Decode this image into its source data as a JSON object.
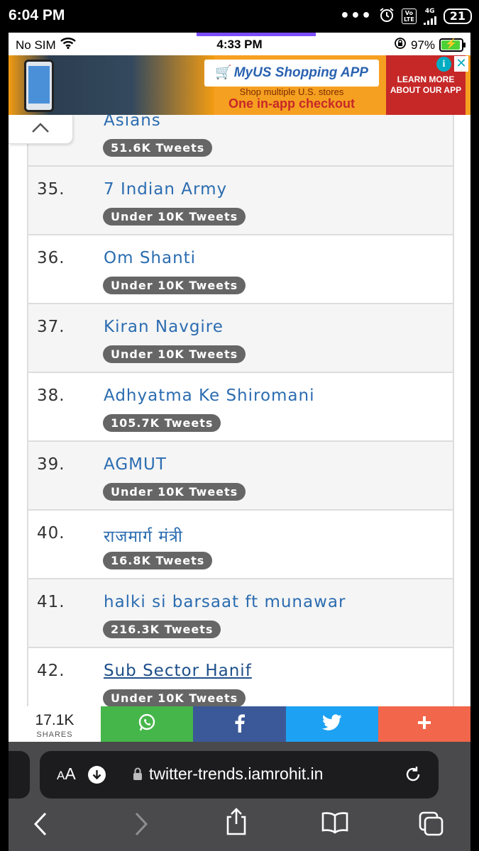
{
  "android_status": {
    "time": "6:04 PM",
    "dots": "•••",
    "volte": "Vo\nLTE",
    "network": "4G",
    "battery": "21"
  },
  "ios_status": {
    "carrier": "No SIM",
    "time": "4:33 PM",
    "battery_percent": "97%"
  },
  "ad": {
    "logo": "MyUS Shopping APP",
    "line1": "Shop multiple U.S. stores",
    "line2": "One in-app checkout",
    "cta": "LEARN MORE ABOUT OUR APP",
    "info": "i",
    "close": "✕"
  },
  "trends": [
    {
      "rank": "",
      "title": "Asians",
      "tweets": "51.6K Tweets"
    },
    {
      "rank": "35.",
      "title": "7 Indian Army",
      "tweets": "Under 10K Tweets"
    },
    {
      "rank": "36.",
      "title": "Om Shanti",
      "tweets": "Under 10K Tweets"
    },
    {
      "rank": "37.",
      "title": "Kiran Navgire",
      "tweets": "Under 10K Tweets"
    },
    {
      "rank": "38.",
      "title": "Adhyatma Ke Shiromani",
      "tweets": "105.7K Tweets"
    },
    {
      "rank": "39.",
      "title": "AGMUT",
      "tweets": "Under 10K Tweets"
    },
    {
      "rank": "40.",
      "title": "राजमार्ग मंत्री",
      "tweets": "16.8K Tweets"
    },
    {
      "rank": "41.",
      "title": "halki si barsaat ft munawar",
      "tweets": "216.3K Tweets"
    },
    {
      "rank": "42.",
      "title": "Sub Sector Hanif",
      "tweets": "Under 10K Tweets"
    }
  ],
  "share": {
    "count": "17.1K",
    "label": "SHARES"
  },
  "safari": {
    "aa_small": "A",
    "aa_big": "A",
    "url": "twitter-trends.iamrohit.in"
  },
  "colors": {
    "link": "#2b6cb0",
    "badge": "#666666",
    "whatsapp": "#45b649",
    "facebook": "#3b5998",
    "twitter": "#1da1f2",
    "more": "#f2664b"
  }
}
